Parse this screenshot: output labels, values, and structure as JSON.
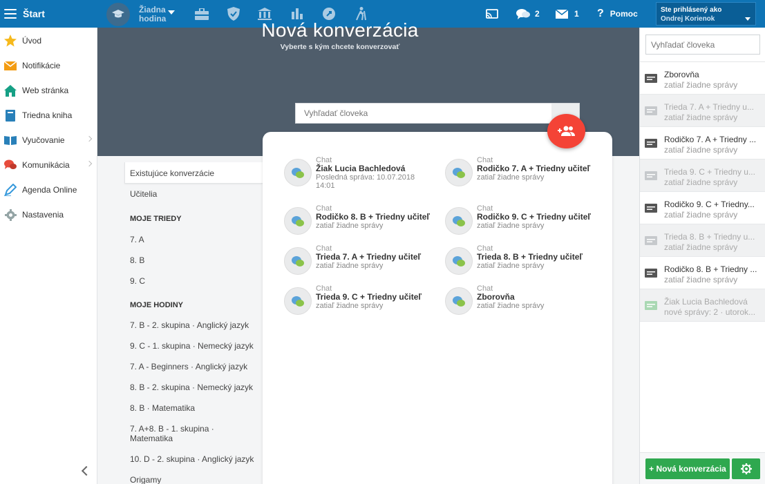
{
  "topbar": {
    "start_label": "Štart",
    "hour_label_1": "Žiadna",
    "hour_label_2": "hodina",
    "messages_count": "2",
    "mail_count": "1",
    "help_label": "Pomoc",
    "user_line1": "Ste prihlásený ako",
    "user_line2": "Ondrej Korienok"
  },
  "sidebar": {
    "items": [
      {
        "label": "Úvod",
        "icon": "star-icon"
      },
      {
        "label": "Notifikácie",
        "icon": "envelope-icon"
      },
      {
        "label": "Web stránka",
        "icon": "home-icon"
      },
      {
        "label": "Triedna kniha",
        "icon": "book-icon"
      },
      {
        "label": "Vyučovanie",
        "icon": "open-book-icon"
      },
      {
        "label": "Komunikácia",
        "icon": "chat-icon"
      },
      {
        "label": "Agenda Online",
        "icon": "pen-icon"
      },
      {
        "label": "Nastavenia",
        "icon": "gear-icon"
      }
    ]
  },
  "hero": {
    "title": "Nová konverzácia",
    "subtitle": "Vyberte s kým chcete konverzovať",
    "search_placeholder": "Vyhľadať človeka"
  },
  "convlist": {
    "existing": "Existujúce konverzácie",
    "teachers": "Učitelia",
    "my_classes_heading": "MOJE TRIEDY",
    "classes": [
      "7. A",
      "8. B",
      "9. C"
    ],
    "my_lessons_heading": "MOJE HODINY",
    "lessons": [
      "7. B - 2. skupina · Anglický jazyk",
      "9. C - 1. skupina · Nemecký jazyk",
      "7. A - Beginners · Anglický jazyk",
      "8. B - 2. skupina · Nemecký jazyk",
      "8. B · Matematika",
      "7. A+8. B - 1. skupina ·",
      "Matematika",
      "10. D - 2. skupina · Anglický jazyk",
      "Origamy"
    ]
  },
  "chats": [
    {
      "kind": "Chat",
      "name": "Žiak Lucia Bachledová",
      "sub1": "Posledná správa: 10.07.2018",
      "sub2": "14:01"
    },
    {
      "kind": "Chat",
      "name": "Rodičko 7. A + Triedny učiteľ",
      "sub1": "zatiaľ žiadne správy",
      "sub2": ""
    },
    {
      "kind": "Chat",
      "name": "Rodičko 8. B + Triedny učiteľ",
      "sub1": "zatiaľ žiadne správy",
      "sub2": ""
    },
    {
      "kind": "Chat",
      "name": "Rodičko 9. C + Triedny učiteľ",
      "sub1": "zatiaľ žiadne správy",
      "sub2": ""
    },
    {
      "kind": "Chat",
      "name": "Trieda 7. A + Triedny učiteľ",
      "sub1": "zatiaľ žiadne správy",
      "sub2": ""
    },
    {
      "kind": "Chat",
      "name": "Trieda 8. B + Triedny učiteľ",
      "sub1": "zatiaľ žiadne správy",
      "sub2": ""
    },
    {
      "kind": "Chat",
      "name": "Trieda 9. C + Triedny učiteľ",
      "sub1": "zatiaľ žiadne správy",
      "sub2": ""
    },
    {
      "kind": "Chat",
      "name": "Zborovňa",
      "sub1": "zatiaľ žiadne správy",
      "sub2": ""
    }
  ],
  "rpanel": {
    "search_placeholder": "Vyhľadať človeka",
    "items": [
      {
        "name": "Zborovňa",
        "sub": "zatiaľ žiadne správy",
        "dim": false
      },
      {
        "name": "Trieda 7. A + Triedny u...",
        "sub": "zatiaľ žiadne správy",
        "dim": true
      },
      {
        "name": "Rodičko 7. A + Triedny ...",
        "sub": "zatiaľ žiadne správy",
        "dim": false
      },
      {
        "name": "Trieda 9. C + Triedny u...",
        "sub": "zatiaľ žiadne správy",
        "dim": true
      },
      {
        "name": "Rodičko 9. C + Triedny...",
        "sub": "zatiaľ žiadne správy",
        "dim": false
      },
      {
        "name": "Trieda 8. B + Triedny u...",
        "sub": "zatiaľ žiadne správy",
        "dim": true
      },
      {
        "name": "Rodičko 8. B + Triedny ...",
        "sub": "zatiaľ žiadne správy",
        "dim": false
      },
      {
        "name": "Žiak Lucia Bachledová",
        "sub": "nové správy: 2 · utorok...",
        "dim": true
      }
    ],
    "new_conv_label": "+ Nová konverzácia"
  },
  "colors": {
    "topbar": "#0f74b5",
    "hero": "#4f5d6b",
    "fab": "#f44336",
    "green_button": "#2fa84f"
  }
}
